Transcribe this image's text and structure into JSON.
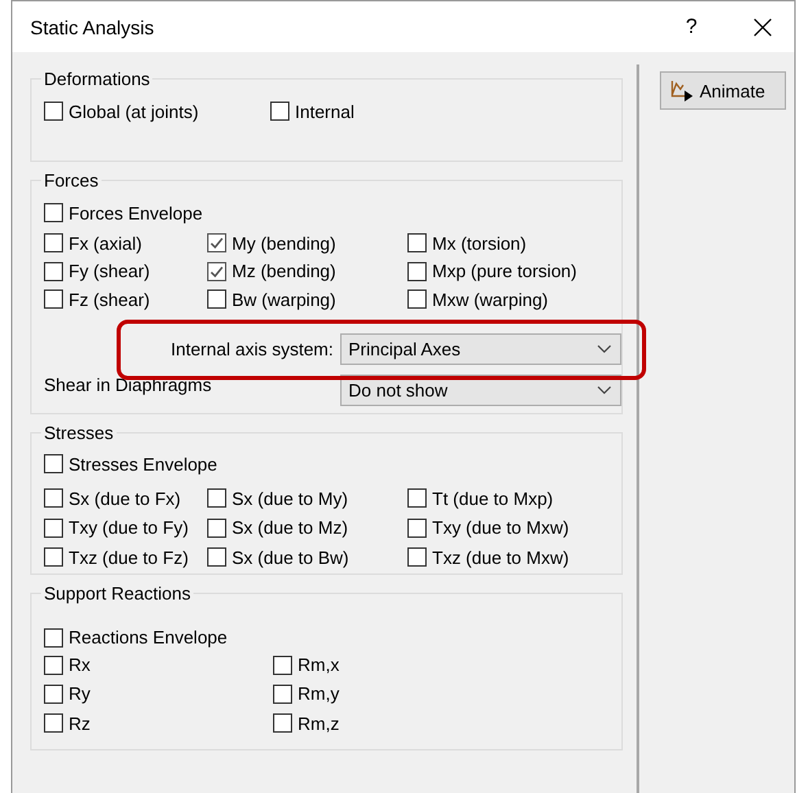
{
  "window": {
    "title": "Static Analysis",
    "help": "?"
  },
  "animate_button": {
    "label": "Animate"
  },
  "deformations": {
    "title": "Deformations",
    "options": [
      {
        "label": "Global (at joints)",
        "checked": false
      },
      {
        "label": "Internal",
        "checked": false
      }
    ]
  },
  "forces": {
    "title": "Forces",
    "envelope": {
      "label": "Forces Envelope",
      "checked": false
    },
    "columns": [
      [
        {
          "label": "Fx (axial)",
          "checked": false
        },
        {
          "label": "Fy (shear)",
          "checked": false
        },
        {
          "label": "Fz (shear)",
          "checked": false
        }
      ],
      [
        {
          "label": "My (bending)",
          "checked": true
        },
        {
          "label": "Mz (bending)",
          "checked": true
        },
        {
          "label": "Bw (warping)",
          "checked": false
        }
      ],
      [
        {
          "label": "Mx (torsion)",
          "checked": false
        },
        {
          "label": "Mxp (pure torsion)",
          "checked": false
        },
        {
          "label": "Mxw (warping)",
          "checked": false
        }
      ]
    ],
    "axis_system": {
      "label": "Internal axis system:",
      "value": "Principal Axes",
      "highlighted": true
    },
    "shear_in_diaphragms": {
      "label": "Shear in Diaphragms",
      "value": "Do not show"
    }
  },
  "stresses": {
    "title": "Stresses",
    "envelope": {
      "label": "Stresses Envelope",
      "checked": false
    },
    "columns": [
      [
        {
          "label": "Sx (due to Fx)",
          "checked": false
        },
        {
          "label": "Txy (due to Fy)",
          "checked": false
        },
        {
          "label": "Txz (due to Fz)",
          "checked": false
        }
      ],
      [
        {
          "label": "Sx (due to My)",
          "checked": false
        },
        {
          "label": "Sx (due to Mz)",
          "checked": false
        },
        {
          "label": "Sx (due to Bw)",
          "checked": false
        }
      ],
      [
        {
          "label": "Tt (due to Mxp)",
          "checked": false
        },
        {
          "label": "Txy (due to Mxw)",
          "checked": false
        },
        {
          "label": "Txz (due to Mxw)",
          "checked": false
        }
      ]
    ]
  },
  "support_reactions": {
    "title": "Support Reactions",
    "envelope": {
      "label": "Reactions Envelope",
      "checked": false
    },
    "columns": [
      [
        {
          "label": "Rx",
          "checked": false
        },
        {
          "label": "Ry",
          "checked": false
        },
        {
          "label": "Rz",
          "checked": false
        }
      ],
      [
        {
          "label": "Rm,x",
          "checked": false
        },
        {
          "label": "Rm,y",
          "checked": false
        },
        {
          "label": "Rm,z",
          "checked": false
        }
      ]
    ]
  }
}
